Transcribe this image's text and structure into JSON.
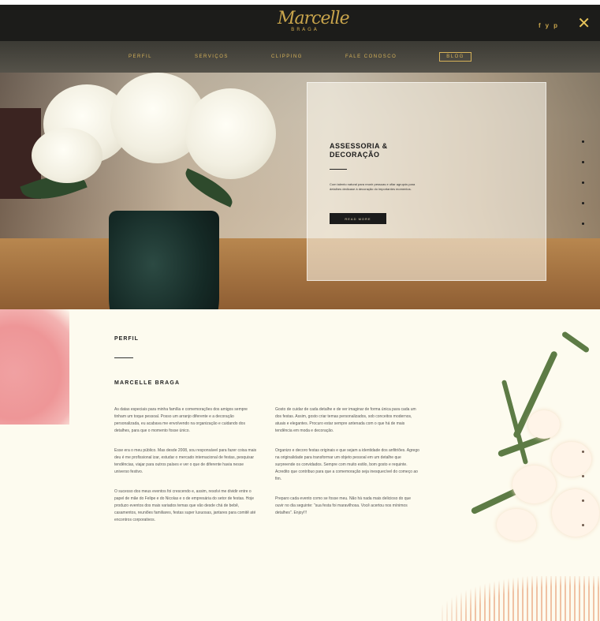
{
  "header": {
    "logo_script": "Marcelle",
    "logo_sub": "BRAGA",
    "social": [
      "f",
      "y",
      "p"
    ],
    "close_icon": "close-icon"
  },
  "nav": {
    "items": [
      "PERFIL",
      "SERVIÇOS",
      "CLIPPING",
      "FALE CONOSCO",
      "BLOG"
    ]
  },
  "hero": {
    "title": "ASSESSORIA & DECORAÇÃO",
    "text": "Com talento natural para reunir pessoas e ofiar agrupós para detalhes dedicase à decoração do importantes momentos.",
    "button": "READ MORE"
  },
  "profile": {
    "label": "PERFIL",
    "name": "MARCELLE BRAGA",
    "col1": [
      "As datas especiais para minha família e comemorações dos amigos sempre tinham um toque pessoal. Posso um arranjo diferente e a decoração personalizada, eu acabava me envolvendo na organização e cuidando dos detalhes, para que o momento fosse único.",
      "Esse era o meu público. Mas desde 2008, sou responsável para fazer coisa mais deu é me profissional izar, estudar o mercado internacional de festas, pesquisar tendências, viajar para outros países e ver o que de diferente havia nesse universo festivo.",
      "O sucesso dos meus eventos foi crescendo e, assim, resolvi me dividir entre o papel de mãe do Felipe e do Nicolas e o de empresária do setor de festas. Hoje produzo eventos dos mais variados temas que vão desde chá de bebê, casamentos, reuniões familiares, festas super luxuosas, jantares para comitê até encontros corporativos."
    ],
    "col2": [
      "Gosto de cuidar de cada detalhe e de ver imaginar de forma única para cada um dos festas. Assim, gosto criar temas personalizados, sob conceitos modernos, atuais e elegantes. Procuro estar sempre antenada com o que há de mais tendência em moda e decoração.",
      "Organizo e decoro festas originais e que sejam a identidade dos anfitriões. Agrego na originalidade para transformar um objeto pessoal em um detalhe que surpreende os convidados. Sempre com muito estilo, bom gosto e requinte. Acredito que contribuo para que a comemoração seja inesquecível do começo ao fim.",
      "Preparo cada evento como se fosse meu. Não há nada mais delicioso do que ouvir no dia seguinte: \"sua festa foi maravilhosa. Você acertou nos mínimos detalhes\". Enjoy!!!"
    ]
  },
  "colors": {
    "accent": "#c9a54c",
    "header_bg": "#1c1c1a",
    "page_bg": "#fdfbef",
    "pink": "#ee9697"
  }
}
